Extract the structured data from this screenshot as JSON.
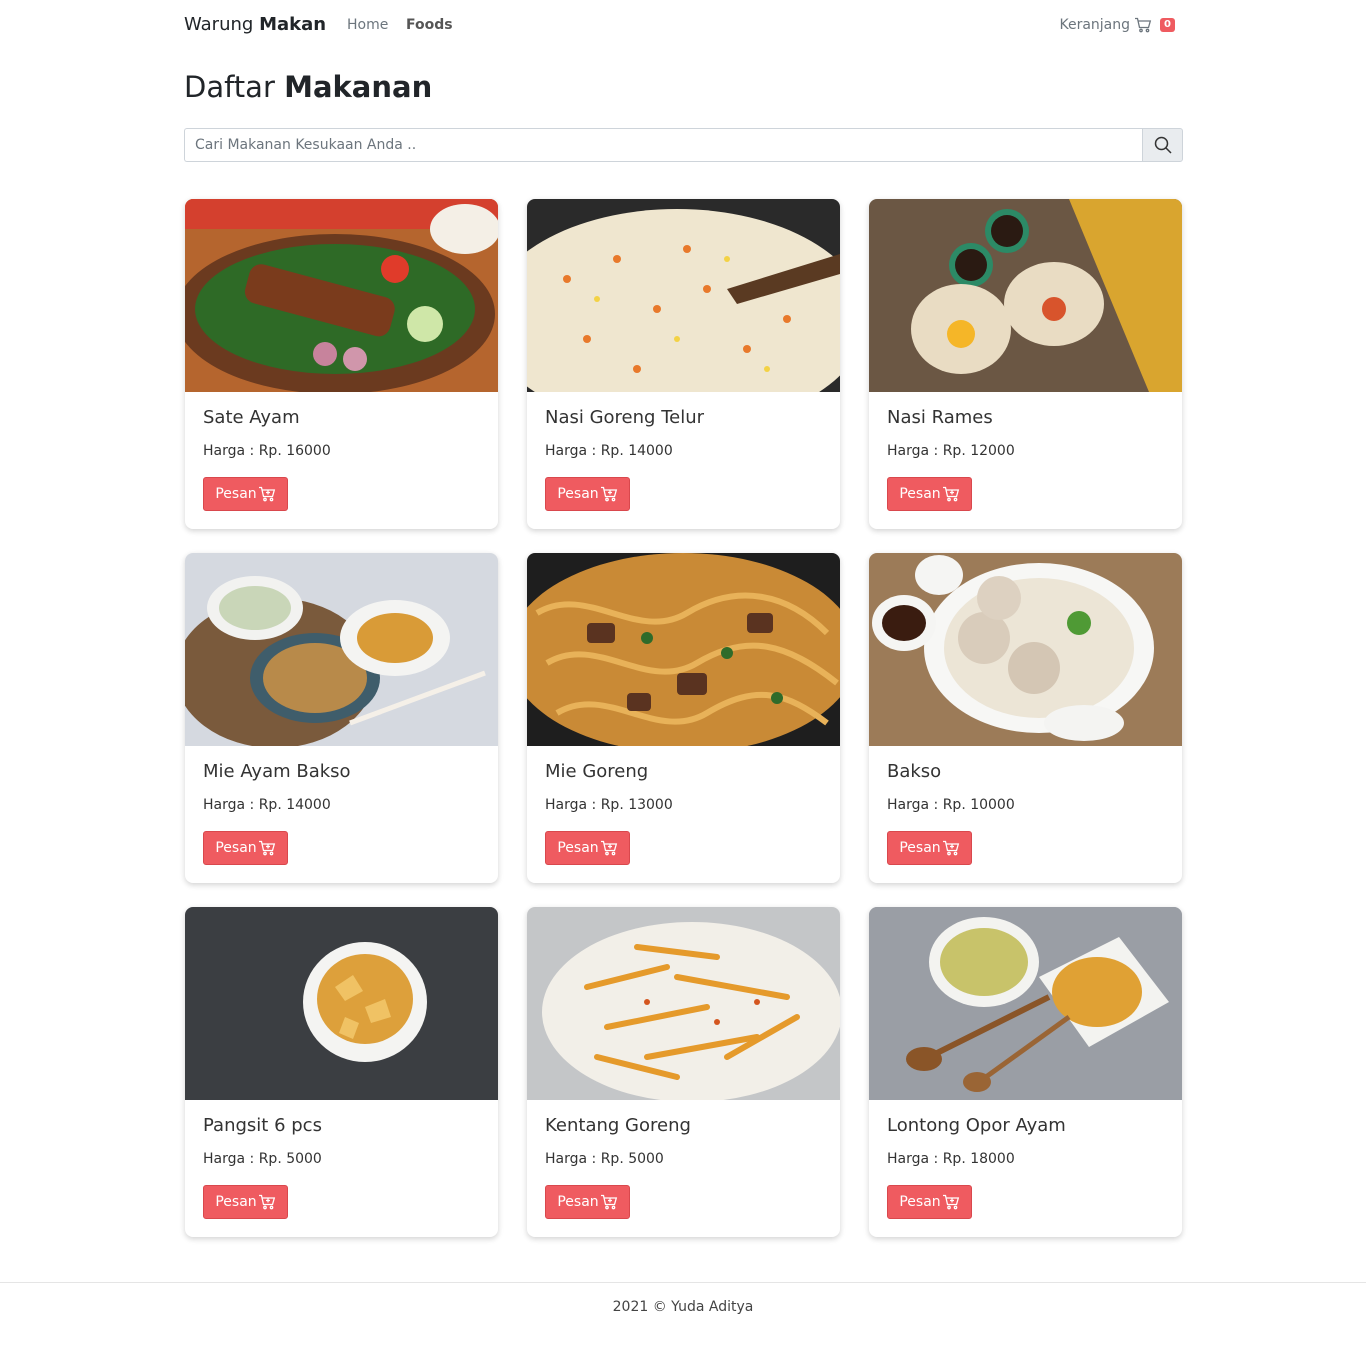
{
  "navbar": {
    "brand_light": "Warung",
    "brand_bold": "Makan",
    "links": [
      "Home",
      "Foods"
    ],
    "cart_label": "Keranjang",
    "cart_count": "0"
  },
  "page": {
    "title_light": "Daftar",
    "title_bold": "Makanan"
  },
  "search": {
    "placeholder": "Cari Makanan Kesukaan Anda .."
  },
  "foods": [
    {
      "name": "Sate Ayam",
      "price": "Harga : Rp. 16000",
      "button": "Pesan"
    },
    {
      "name": "Nasi Goreng Telur",
      "price": "Harga : Rp. 14000",
      "button": "Pesan"
    },
    {
      "name": "Nasi Rames",
      "price": "Harga : Rp. 12000",
      "button": "Pesan"
    },
    {
      "name": "Mie Ayam Bakso",
      "price": "Harga : Rp. 14000",
      "button": "Pesan"
    },
    {
      "name": "Mie Goreng",
      "price": "Harga : Rp. 13000",
      "button": "Pesan"
    },
    {
      "name": "Bakso",
      "price": "Harga : Rp. 10000",
      "button": "Pesan"
    },
    {
      "name": "Pangsit 6 pcs",
      "price": "Harga : Rp. 5000",
      "button": "Pesan"
    },
    {
      "name": "Kentang Goreng",
      "price": "Harga : Rp. 5000",
      "button": "Pesan"
    },
    {
      "name": "Lontong Opor Ayam",
      "price": "Harga : Rp. 18000",
      "button": "Pesan"
    }
  ],
  "footer": {
    "text": "2021 © Yuda Aditya"
  },
  "colors": {
    "accent": "#ef5b60",
    "muted": "#6c757d"
  }
}
